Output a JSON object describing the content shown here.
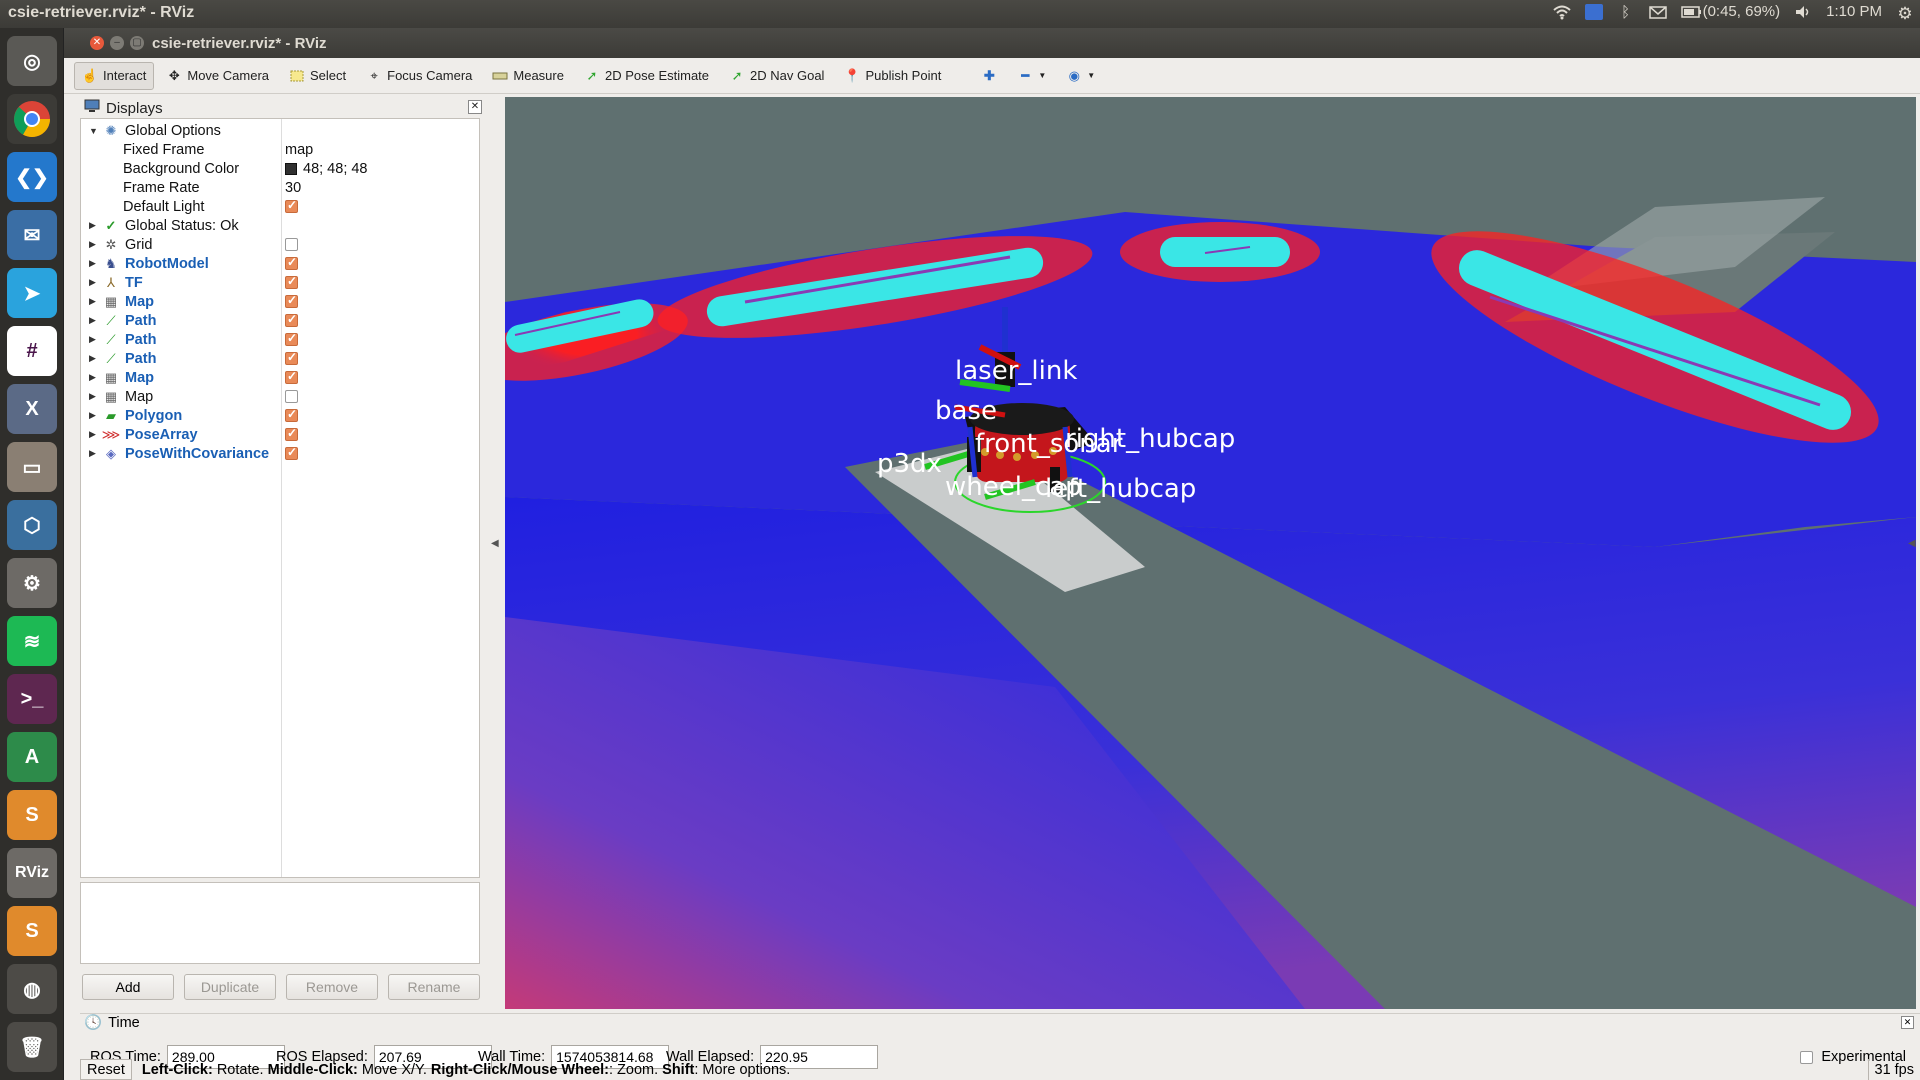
{
  "topbar": {
    "title": "csie-retriever.rviz* - RViz",
    "battery": "(0:45, 69%)",
    "clock": "1:10 PM"
  },
  "launcher": {
    "apps": [
      "ubuntu-dash",
      "chrome",
      "vscode",
      "thunderbird",
      "telegram",
      "slack",
      "xserver",
      "file-manager",
      "virtualbox",
      "system-settings",
      "spotify",
      "terminal",
      "software-updater",
      "sublime",
      "rviz",
      "sublime-2",
      "game-controller",
      "trash"
    ]
  },
  "window": {
    "title": "csie-retriever.rviz* - RViz"
  },
  "toolbar": {
    "interact": "Interact",
    "move_camera": "Move Camera",
    "select": "Select",
    "focus_camera": "Focus Camera",
    "measure": "Measure",
    "pose_estimate": "2D Pose Estimate",
    "nav_goal": "2D Nav Goal",
    "publish_point": "Publish Point"
  },
  "displays": {
    "header": "Displays",
    "global_options": {
      "label": "Global Options",
      "fixed_frame_label": "Fixed Frame",
      "fixed_frame": "map",
      "bg_color_label": "Background Color",
      "bg_color": "48; 48; 48",
      "frame_rate_label": "Frame Rate",
      "frame_rate": "30",
      "default_light_label": "Default Light"
    },
    "global_status": "Global Status: Ok",
    "items": [
      {
        "label": "Grid",
        "enabled": false,
        "colored": false
      },
      {
        "label": "RobotModel",
        "enabled": true,
        "colored": true
      },
      {
        "label": "TF",
        "enabled": true,
        "colored": true
      },
      {
        "label": "Map",
        "enabled": true,
        "colored": true
      },
      {
        "label": "Path",
        "enabled": true,
        "colored": true
      },
      {
        "label": "Path",
        "enabled": true,
        "colored": true
      },
      {
        "label": "Path",
        "enabled": true,
        "colored": true
      },
      {
        "label": "Map",
        "enabled": true,
        "colored": true
      },
      {
        "label": "Map",
        "enabled": false,
        "colored": false
      },
      {
        "label": "Polygon",
        "enabled": true,
        "colored": true
      },
      {
        "label": "PoseArray",
        "enabled": true,
        "colored": true
      },
      {
        "label": "PoseWithCovariance",
        "enabled": true,
        "colored": true
      }
    ],
    "buttons": {
      "add": "Add",
      "duplicate": "Duplicate",
      "remove": "Remove",
      "rename": "Rename"
    }
  },
  "viewport": {
    "frame_labels": [
      "laser_link",
      "base",
      "front_sonar",
      "p3dx",
      "wheel_cap",
      "right_hubcap",
      "left_hubcap"
    ]
  },
  "time": {
    "header": "Time",
    "ros_time_label": "ROS Time:",
    "ros_time": "289.00",
    "ros_elapsed_label": "ROS Elapsed:",
    "ros_elapsed": "207.69",
    "wall_time_label": "Wall Time:",
    "wall_time": "1574053814.68",
    "wall_elapsed_label": "Wall Elapsed:",
    "wall_elapsed": "220.95",
    "experimental": "Experimental"
  },
  "status": {
    "reset": "Reset",
    "hint_left_bold": "Left-Click:",
    "hint_left": " Rotate. ",
    "hint_middle_bold": "Middle-Click:",
    "hint_middle": " Move X/Y. ",
    "hint_right_bold": "Right-Click/Mouse Wheel:",
    "hint_right": ": Zoom. ",
    "hint_shift_bold": "Shift",
    "hint_shift": ": More options.",
    "fps": "31 fps"
  },
  "colors": {
    "ubuntu_bar": "#3c3b37",
    "accent_orange": "#e98a58",
    "link_blue": "#1a5fb4",
    "costmap_blue": "#2a2ad6",
    "inflation_cyan": "#3ae6e6"
  }
}
